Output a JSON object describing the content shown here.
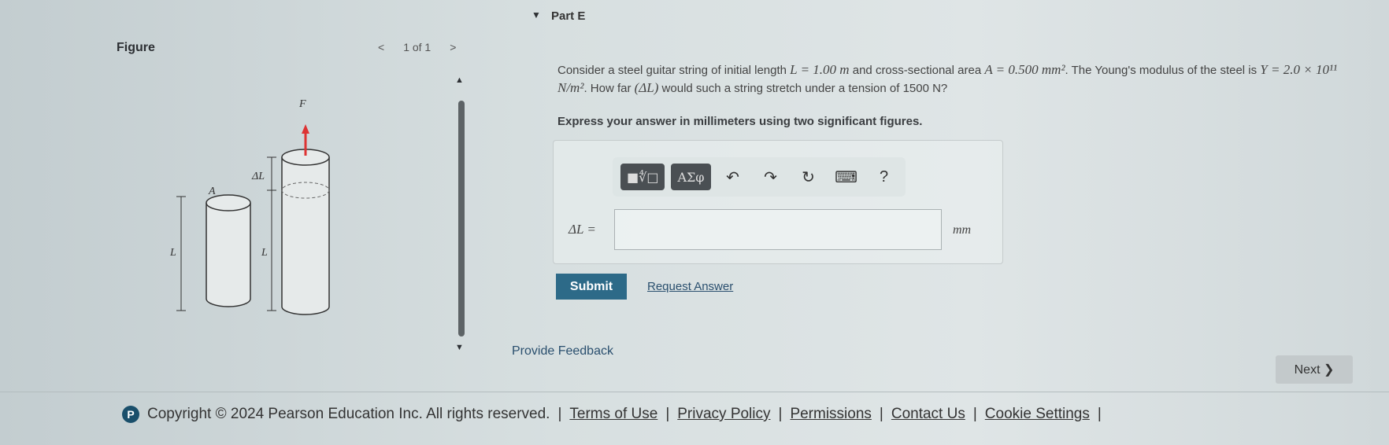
{
  "part": {
    "title": "Part E"
  },
  "figure": {
    "label": "Figure",
    "pager": "1 of 1",
    "prev": "<",
    "next": ">",
    "labels": {
      "force": "F",
      "delta_l": "ΔL",
      "area": "A",
      "length_left": "L",
      "length_right": "L"
    }
  },
  "question": {
    "t1": "Consider a steel guitar string of initial length ",
    "L": "L = 1.00 m",
    "t2": " and cross-sectional area ",
    "A": "A = 0.500 mm²",
    "t3": ". The Young's modulus of the steel is ",
    "Y": "Y = 2.0 × 10¹¹ N/m²",
    "t4": ". How far ",
    "dL": "(ΔL)",
    "t5": " would such a string stretch under a tension of 1500 N?",
    "instruction": "Express your answer in millimeters using two significant figures."
  },
  "toolbar": {
    "templates": "■∜□",
    "symbols": "ΑΣφ",
    "undo": "↶",
    "redo": "↷",
    "reset": "↻",
    "keyboard": "⌨",
    "help": "?"
  },
  "answer": {
    "label": "ΔL =",
    "value": "",
    "unit": "mm"
  },
  "actions": {
    "submit": "Submit",
    "request": "Request Answer",
    "feedback": "Provide Feedback",
    "next": "Next ❯"
  },
  "footer": {
    "logo": "P",
    "copyright": "Copyright © 2024  Pearson Education Inc. All rights reserved.",
    "links": [
      "Terms of Use",
      "Privacy Policy",
      "Permissions",
      "Contact Us",
      "Cookie Settings"
    ]
  }
}
